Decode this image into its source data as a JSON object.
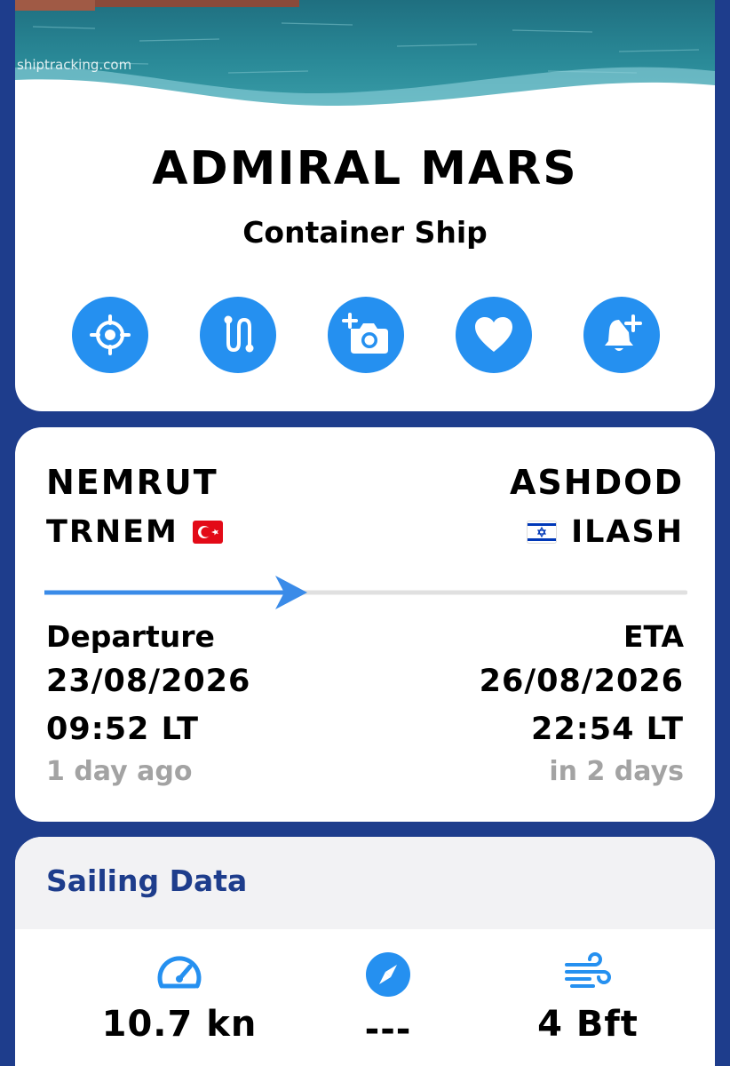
{
  "hero": {
    "watermark": "shiptracking.com"
  },
  "ship": {
    "name": "ADMIRAL MARS",
    "type": "Container Ship"
  },
  "actions": [
    {
      "icon": "target-icon",
      "label": "locate"
    },
    {
      "icon": "route-icon",
      "label": "route"
    },
    {
      "icon": "add-photo-icon",
      "label": "add photo"
    },
    {
      "icon": "heart-icon",
      "label": "favorite"
    },
    {
      "icon": "bell-plus-icon",
      "label": "alert"
    }
  ],
  "route": {
    "origin": {
      "name": "NEMRUT",
      "code": "TRNEM",
      "flag": "turkey-flag-icon"
    },
    "destination": {
      "name": "ASHDOD",
      "code": "ILASH",
      "flag": "israel-flag-icon"
    },
    "progress": 0.41,
    "departure": {
      "label": "Departure",
      "date": "23/08/2026",
      "time": "09:52 LT",
      "relative": "1 day ago"
    },
    "arrival": {
      "label": "ETA",
      "date": "26/08/2026",
      "time": "22:54 LT",
      "relative": "in 2 days"
    }
  },
  "sailing": {
    "title": "Sailing Data",
    "stats": [
      {
        "icon": "speedometer-icon",
        "value": "10.7 kn"
      },
      {
        "icon": "compass-icon",
        "value": "---"
      },
      {
        "icon": "wind-icon",
        "value": "4 Bft"
      }
    ]
  },
  "colors": {
    "background": "#1e3d8c",
    "accent": "#2590f0",
    "track": "#e0e0e0",
    "muted": "#a3a3a3"
  }
}
